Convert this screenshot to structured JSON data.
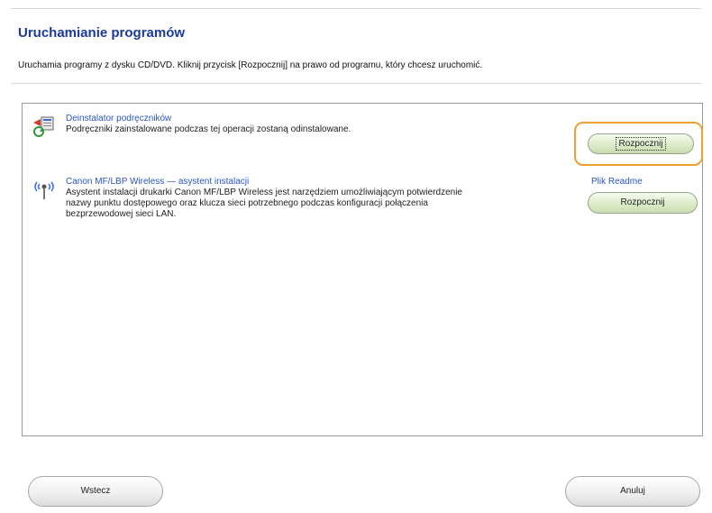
{
  "header": {
    "title": "Uruchamianie programów",
    "intro": "Uruchamia programy z dysku CD/DVD. Kliknij przycisk [Rozpocznij] na prawo od programu, który chcesz uruchomić."
  },
  "programs": [
    {
      "name": "Deinstalator podręczników",
      "description": "Podręczniki zainstalowane podczas tej operacji zostaną odinstalowane.",
      "button_label": "Rozpocznij",
      "icon": "uninstaller-icon"
    },
    {
      "name": "Canon MF/LBP Wireless — asystent instalacji",
      "description_lines": [
        "Asystent instalacji drukarki Canon MF/LBP Wireless jest narzędziem umożliwiającym potwierdzenie",
        "nazwy punktu dostępowego oraz klucza sieci potrzebnego podczas konfiguracji połączenia",
        "bezprzewodowej sieci LAN."
      ],
      "readme_label": "Plik Readme",
      "button_label": "Rozpocznij",
      "icon": "wireless-icon"
    }
  ],
  "footer": {
    "back_label": "Wstecz",
    "cancel_label": "Anuluj"
  },
  "colors": {
    "title": "#1a3a9c",
    "link": "#2b55c4",
    "focus": "#f0a030"
  }
}
